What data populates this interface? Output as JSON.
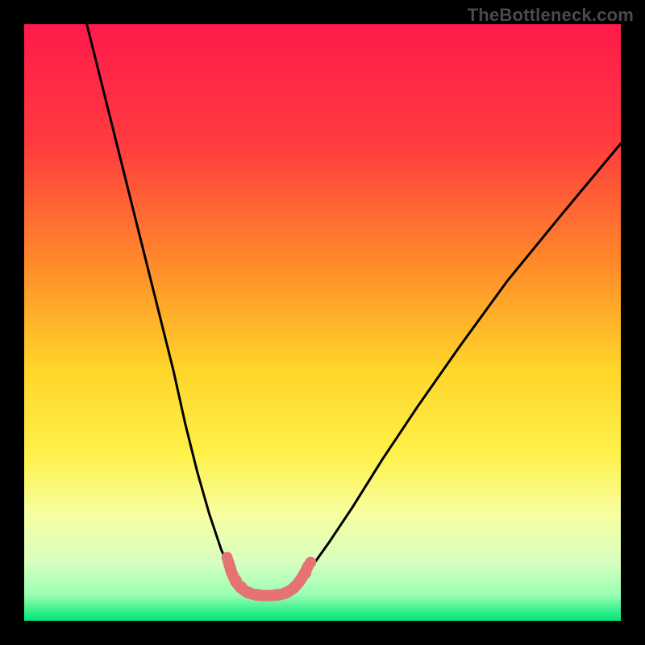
{
  "watermark": "TheBottleneck.com",
  "chart_data": {
    "type": "line",
    "title": "",
    "xlabel": "",
    "ylabel": "",
    "xlim": [
      0,
      100
    ],
    "ylim": [
      0,
      100
    ],
    "grid": false,
    "legend": false,
    "background_gradient_stops": [
      {
        "offset": 0.0,
        "color": "#ff1a4b"
      },
      {
        "offset": 0.2,
        "color": "#ff3b3f"
      },
      {
        "offset": 0.4,
        "color": "#ff8a2a"
      },
      {
        "offset": 0.58,
        "color": "#ffd62a"
      },
      {
        "offset": 0.72,
        "color": "#fff04a"
      },
      {
        "offset": 0.82,
        "color": "#f7ffa0"
      },
      {
        "offset": 0.9,
        "color": "#d8ffc0"
      },
      {
        "offset": 0.955,
        "color": "#9dffb4"
      },
      {
        "offset": 1.0,
        "color": "#00e676"
      }
    ],
    "series": [
      {
        "name": "left-branch",
        "color": "#000000",
        "x": [
          10.5,
          13,
          16,
          19,
          22,
          25,
          27,
          29,
          31,
          33,
          34.5,
          35.5,
          36.3
        ],
        "y": [
          100,
          90,
          78,
          66,
          54,
          42,
          33,
          25,
          18,
          12,
          8.5,
          6.5,
          5.5
        ]
      },
      {
        "name": "right-branch",
        "color": "#000000",
        "x": [
          45.2,
          46.5,
          48.5,
          51,
          55,
          60,
          66,
          73,
          81,
          90,
          100
        ],
        "y": [
          5.5,
          7.0,
          9.5,
          13,
          19,
          27,
          36,
          46,
          57,
          68,
          80
        ]
      },
      {
        "name": "valley-highlight",
        "color": "#e57373",
        "x": [
          34.2,
          34.8,
          35.5,
          36.3,
          37.5,
          39.0,
          40.7,
          42.5,
          44.0,
          45.2,
          46.0,
          46.8,
          47.6
        ],
        "y": [
          10.0,
          8.0,
          6.5,
          5.5,
          4.7,
          4.3,
          4.2,
          4.3,
          4.7,
          5.5,
          6.4,
          7.6,
          9.2
        ]
      },
      {
        "name": "valley-highlight-dots",
        "type": "scatter",
        "color": "#e57373",
        "x": [
          34.0,
          34.6,
          35.5,
          36.4,
          37.6,
          39.2,
          40.7,
          42.3,
          43.9,
          45.3,
          46.2,
          47.2,
          48.0
        ],
        "y": [
          10.6,
          8.5,
          6.8,
          5.7,
          4.8,
          4.4,
          4.2,
          4.4,
          4.8,
          5.7,
          6.7,
          8.0,
          9.8
        ]
      }
    ]
  }
}
